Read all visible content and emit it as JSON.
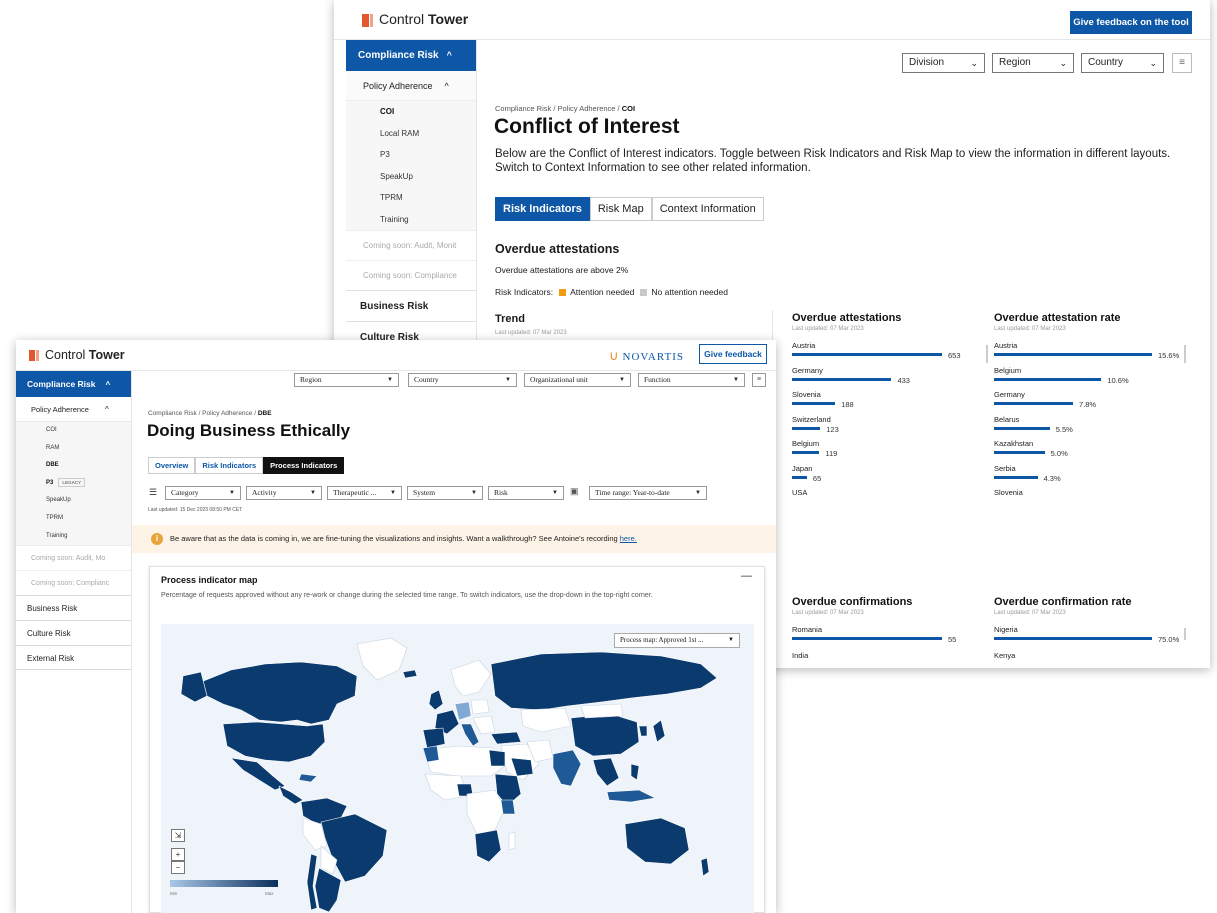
{
  "back_window": {
    "app": {
      "logo_light": "Control",
      "logo_bold": "Tower",
      "feedback_label": "Give feedback on the tool"
    },
    "sidebar": {
      "section": "Compliance Risk",
      "subsection": "Policy Adherence",
      "items": [
        "COI",
        "Local RAM",
        "P3",
        "SpeakUp",
        "TPRM",
        "Training"
      ],
      "active_item": "COI",
      "coming_soon": [
        "Coming soon: Audit, Monit",
        "Coming soon: Compliance"
      ],
      "top_items": [
        "Business Risk",
        "Culture Risk"
      ]
    },
    "filters": {
      "division": "Division",
      "region": "Region",
      "country": "Country"
    },
    "breadcrumb": {
      "path": "Compliance Risk / Policy Adherence / ",
      "current": "COI"
    },
    "title": "Conflict of Interest",
    "description": "Below are the Conflict of Interest indicators. Toggle between Risk Indicators and Risk Map to view the information in different layouts. Switch to Context Information to see other related information.",
    "tabs": [
      "Risk Indicators",
      "Risk Map",
      "Context Information"
    ],
    "section_title": "Overdue attestations",
    "section_text": "Overdue attestations are above 2%",
    "legend": {
      "label": "Risk Indicators:",
      "attention": "Attention needed",
      "no_attention": "No attention needed",
      "attention_color": "#f39c12",
      "no_attention_color": "#c8c8c8"
    },
    "trend": {
      "title": "Trend",
      "updated": "Last updated: 07 Mar 2023"
    },
    "panels": [
      {
        "title": "Overdue attestations",
        "updated": "Last updated: 07 Mar 2023",
        "rows": [
          {
            "country": "Austria",
            "value": 653,
            "label": "653"
          },
          {
            "country": "Germany",
            "value": 433,
            "label": "433"
          },
          {
            "country": "Slovenia",
            "value": 188,
            "label": "188"
          },
          {
            "country": "Switzerland",
            "value": 123,
            "label": "123"
          },
          {
            "country": "Belgium",
            "value": 119,
            "label": "119"
          },
          {
            "country": "Japan",
            "value": 65,
            "label": "65"
          },
          {
            "country": "USA",
            "value": null,
            "label": ""
          }
        ]
      },
      {
        "title": "Overdue attestation rate",
        "updated": "Last updated: 07 Mar 2023",
        "rows": [
          {
            "country": "Austria",
            "value": 15.6,
            "label": "15.6%"
          },
          {
            "country": "Belgium",
            "value": 10.6,
            "label": "10.6%"
          },
          {
            "country": "Germany",
            "value": 7.8,
            "label": "7.8%"
          },
          {
            "country": "Belarus",
            "value": 5.5,
            "label": "5.5%"
          },
          {
            "country": "Kazakhstan",
            "value": 5.0,
            "label": "5.0%"
          },
          {
            "country": "Serbia",
            "value": 4.3,
            "label": "4.3%"
          },
          {
            "country": "Slovenia",
            "value": null,
            "label": ""
          }
        ]
      },
      {
        "title": "Overdue confirmations",
        "updated": "Last updated: 07 Mar 2023",
        "rows": [
          {
            "country": "Romania",
            "value": 55,
            "label": "55"
          },
          {
            "country": "India",
            "value": null,
            "label": ""
          }
        ]
      },
      {
        "title": "Overdue confirmation rate",
        "updated": "Last updated: 07 Mar 2023",
        "rows": [
          {
            "country": "Nigeria",
            "value": 75.0,
            "label": "75.0%"
          },
          {
            "country": "Kenya",
            "value": null,
            "label": ""
          }
        ]
      }
    ]
  },
  "front_window": {
    "app": {
      "logo_light": "Control",
      "logo_bold": "Tower",
      "brand": "NOVARTIS",
      "feedback_label": "Give feedback"
    },
    "sidebar": {
      "section": "Compliance Risk",
      "subsection": "Policy Adherence",
      "items": [
        "COI",
        "RAM",
        "DBE",
        "P3",
        "SpeakUp",
        "TPRM",
        "Training"
      ],
      "active_item": "DBE",
      "p3_badge": "LEGACY",
      "coming_soon": [
        "Coming soon: Audit, Mo",
        "Coming soon: Complianc"
      ],
      "top_items": [
        "Business Risk",
        "Culture Risk",
        "External Risk"
      ]
    },
    "top_filters": [
      "Region",
      "Country",
      "Organizational unit",
      "Function"
    ],
    "breadcrumb": {
      "path": "Compliance Risk / Policy Adherence / ",
      "current": "DBE"
    },
    "title": "Doing Business Ethically",
    "tabs": [
      "Overview",
      "Risk Indicators",
      "Process Indicators"
    ],
    "active_tab": "Process Indicators",
    "sub_filters": [
      "Category",
      "Activity",
      "Therapeutic ...",
      "System",
      "Risk"
    ],
    "time_range": "Time range: Year-to-date",
    "last_updated": "Last updated: 15 Dec 2023 08:50 PM CET",
    "notice": {
      "text": "Be aware that as the data is coming in, we are fine-tuning the visualizations and insights. Want a walkthrough? See Antoine's recording ",
      "link": "here."
    },
    "map_card": {
      "title": "Process indicator map",
      "description": "Percentage of requests approved without any re-work or change during the selected time range. To switch indicators, use the drop-down in the top-right corner.",
      "selector": "Process map: Approved 1st ...",
      "scale_min": "Min",
      "scale_max": "Max",
      "colors": {
        "dark": "#0b3a6e",
        "light": "#a9c8e8",
        "ocean": "#eef4fa"
      }
    }
  }
}
